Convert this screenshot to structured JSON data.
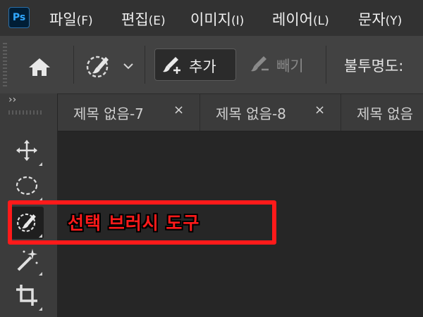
{
  "app": {
    "logo_text": "Ps"
  },
  "menu": [
    {
      "label": "파일",
      "accel": "(F)"
    },
    {
      "label": "편집",
      "accel": "(E)"
    },
    {
      "label": "이미지",
      "accel": "(I)"
    },
    {
      "label": "레이어",
      "accel": "(L)"
    },
    {
      "label": "문자",
      "accel": "(Y)"
    }
  ],
  "options_bar": {
    "home_icon": "home-icon",
    "preset_icon": "selection-brush-icon",
    "add_label": "추가",
    "subtract_label": "빼기",
    "opacity_label": "불투명도:"
  },
  "toolbar": {
    "collapse_label": "››",
    "tools": [
      {
        "name": "move-tool",
        "icon": "move-icon"
      },
      {
        "name": "marquee-tool",
        "icon": "ellipse-marquee-icon"
      },
      {
        "name": "selection-brush-tool",
        "icon": "selection-brush-icon",
        "active": true
      },
      {
        "name": "magic-wand-tool",
        "icon": "magic-wand-icon"
      },
      {
        "name": "crop-tool",
        "icon": "crop-icon"
      }
    ]
  },
  "tabs": [
    {
      "title": "제목 없음-7",
      "close": "×"
    },
    {
      "title": "제목 없음-8",
      "close": "×"
    },
    {
      "title": "제목 없음",
      "close": ""
    }
  ],
  "annotation": {
    "label": "선택 브러시 도구",
    "color": "#ff1a1a"
  },
  "colors": {
    "menubar": "#323232",
    "optionsbar": "#424242",
    "canvas": "#262626",
    "accent": "#31a8ff"
  }
}
